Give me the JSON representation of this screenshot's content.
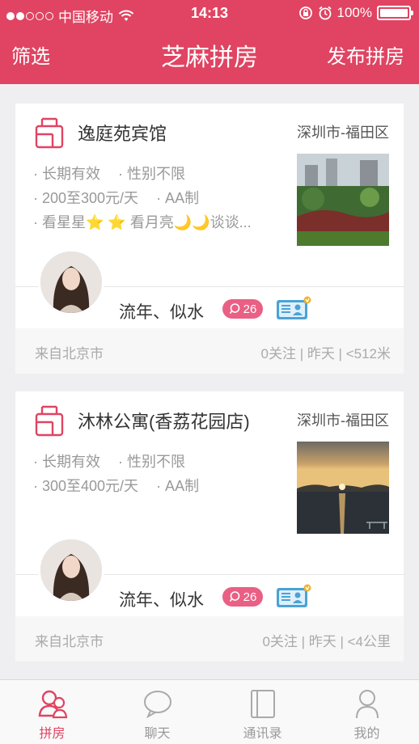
{
  "status": {
    "carrier": "中国移动",
    "time": "14:13",
    "battery": "100%",
    "battery_level": 1.0
  },
  "nav": {
    "filter_label": "筛选",
    "title": "芝麻拼房",
    "publish_label": "发布拼房"
  },
  "listings": [
    {
      "name": "逸庭苑宾馆",
      "city": "深圳市-福田区",
      "attr_row1": [
        "· 长期有效",
        "· 性别不限"
      ],
      "attr_row2": [
        "· 200至300元/天",
        "· AA制"
      ],
      "attr_row3": "· 看星星⭐ ⭐ 看月亮🌙🌙谈谈...",
      "username": "流年、似水",
      "comments": "26",
      "from": "来自北京市",
      "stats": "0关注 | 昨天 | <512米"
    },
    {
      "name": "沐林公寓(香荔花园店)",
      "city": "深圳市-福田区",
      "attr_row1": [
        "· 长期有效",
        "· 性别不限"
      ],
      "attr_row2": [
        "· 300至400元/天",
        "· AA制"
      ],
      "attr_row3": "",
      "username": "流年、似水",
      "comments": "26",
      "from": "来自北京市",
      "stats": "0关注 | 昨天 | <4公里"
    }
  ],
  "tabs": [
    {
      "label": "拼房",
      "icon": "people-icon",
      "active": true
    },
    {
      "label": "聊天",
      "icon": "chat-bubble-icon",
      "active": false
    },
    {
      "label": "通讯录",
      "icon": "address-book-icon",
      "active": false
    },
    {
      "label": "我的",
      "icon": "person-icon",
      "active": false
    }
  ],
  "colors": {
    "brand": "#e04462",
    "badge": "#ea5f84",
    "id_badge": "#4aa3d6"
  }
}
